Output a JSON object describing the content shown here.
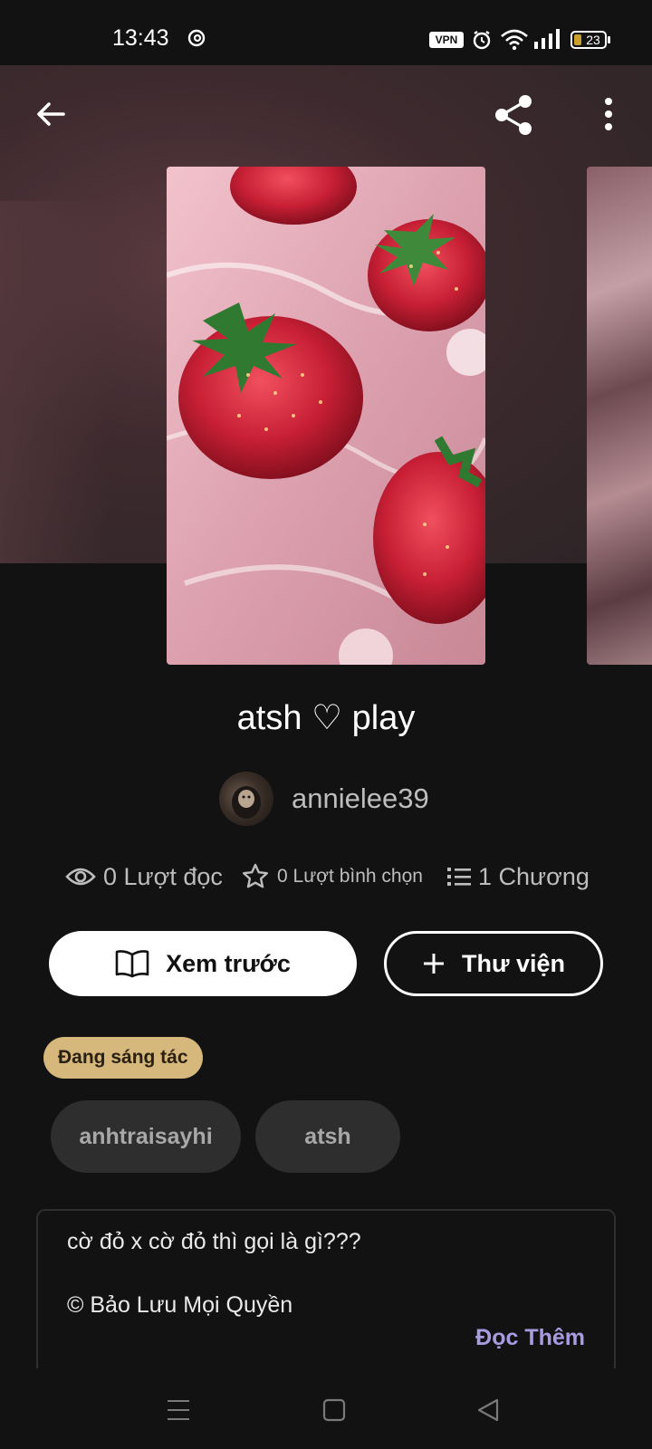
{
  "status_bar": {
    "time": "13:43",
    "vpn_label": "VPN",
    "battery": "23",
    "icons": [
      "threads-icon",
      "alarm-icon",
      "wifi-icon",
      "signal-icon",
      "battery-icon"
    ]
  },
  "toolbar": {
    "icons": [
      "back-arrow-icon",
      "share-icon",
      "more-vertical-icon"
    ]
  },
  "story": {
    "title": "atsh ♡ play",
    "author": "annielee39",
    "stats": {
      "reads": "0 Lượt đọc",
      "votes": "0 Lượt bình chọn",
      "parts": "1 Chương"
    },
    "preview_button": "Xem trước",
    "library_button": "Thư viện",
    "status_badge": "Đang sáng tác",
    "tags": [
      "anhtraisayhi",
      "atsh"
    ],
    "description_line1": "cờ đỏ x cờ đỏ thì gọi là gì???",
    "description_line2": "© Bảo Lưu Mọi Quyền",
    "read_more": "Đọc Thêm"
  },
  "colors": {
    "background": "#121212",
    "badge": "#d6b77c",
    "tag_bg": "#2e2e2e",
    "read_more": "#a99be0"
  }
}
